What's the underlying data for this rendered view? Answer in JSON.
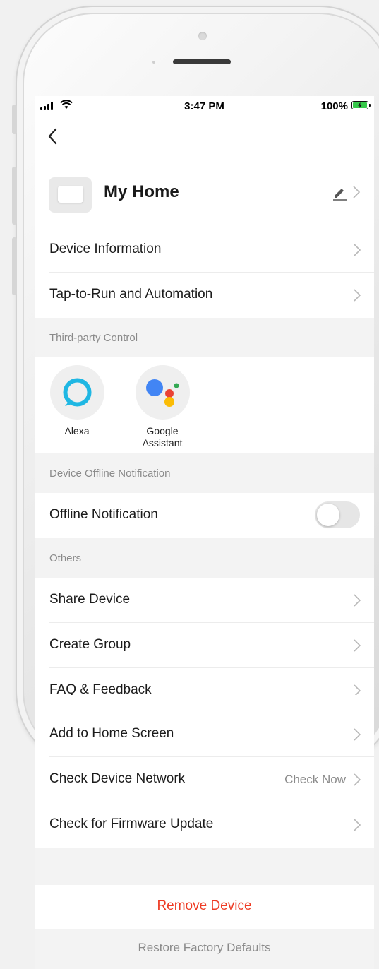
{
  "status_bar": {
    "time": "3:47 PM",
    "battery": "100%"
  },
  "device": {
    "name": "My Home"
  },
  "main_items": [
    {
      "label": "Device Information"
    },
    {
      "label": "Tap-to-Run and Automation"
    }
  ],
  "third_party": {
    "header": "Third-party Control",
    "services": [
      {
        "label": "Alexa",
        "icon": "alexa-icon"
      },
      {
        "label": "Google Assistant",
        "icon": "google-assistant-icon"
      }
    ]
  },
  "offline": {
    "header": "Device Offline Notification",
    "label": "Offline Notification",
    "enabled": false
  },
  "others": {
    "header": "Others",
    "items": [
      {
        "label": "Share Device"
      },
      {
        "label": "Create Group"
      },
      {
        "label": "FAQ & Feedback"
      },
      {
        "label": "Add to Home Screen"
      },
      {
        "label": "Check Device Network",
        "value": "Check Now"
      },
      {
        "label": "Check for Firmware Update"
      }
    ]
  },
  "actions": {
    "remove": "Remove Device",
    "restore": "Restore Factory Defaults"
  },
  "colors": {
    "danger": "#ee3b24",
    "battery": "#36c94a",
    "alexa": "#1fb7e3",
    "google_blue": "#4285f4",
    "google_red": "#ea4335",
    "google_yellow": "#fbbc05",
    "google_green": "#34a853"
  }
}
